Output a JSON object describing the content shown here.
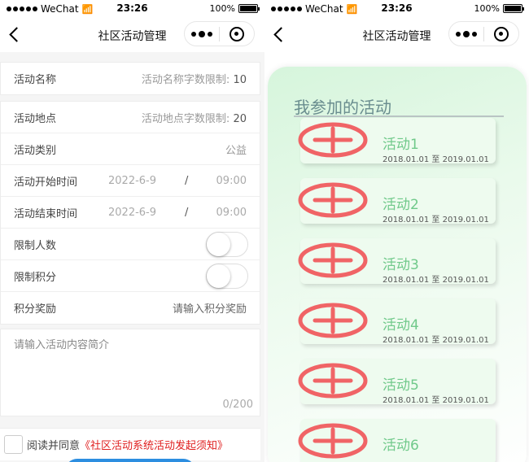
{
  "status": {
    "carrier": "WeChat",
    "time": "23:26",
    "battery": "100%"
  },
  "left": {
    "nav_title": "社区活动管理",
    "rows": {
      "name": {
        "label": "活动名称",
        "hint": "活动名称字数限制:",
        "limit": "10"
      },
      "place": {
        "label": "活动地点",
        "hint": "活动地点字数限制:",
        "limit": "20"
      },
      "category": {
        "label": "活动类别",
        "value": "公益"
      },
      "start": {
        "label": "活动开始时间",
        "date": "2022-6-9",
        "sep": "/",
        "time": "09:00"
      },
      "end": {
        "label": "活动结束时间",
        "date": "2022-6-9",
        "sep": "/",
        "time": "09:00"
      },
      "limit_people": {
        "label": "限制人数"
      },
      "limit_points": {
        "label": "限制积分"
      },
      "reward": {
        "label": "积分奖励",
        "placeholder": "请输入积分奖励"
      }
    },
    "intro_placeholder": "请输入活动内容简介",
    "counter": "0/200",
    "agree_text": "阅读并同意",
    "agree_link": "《社区活动系统活动发起须知》"
  },
  "right": {
    "nav_title": "社区活动管理",
    "section_title": "我参加的活动",
    "items": [
      {
        "name": "活动1",
        "date": "2018.01.01 至 2019.01.01"
      },
      {
        "name": "活动2",
        "date": "2018.01.01 至 2019.01.01"
      },
      {
        "name": "活动3",
        "date": "2018.01.01 至 2019.01.01"
      },
      {
        "name": "活动4",
        "date": "2018.01.01 至 2019.01.01"
      },
      {
        "name": "活动5",
        "date": "2018.01.01 至 2019.01.01"
      },
      {
        "name": "活动6",
        "date": ""
      }
    ]
  },
  "colors": {
    "accent_red": "#f06466",
    "green_text": "#70c98a",
    "link_red": "#e02020",
    "button_blue": "#2d8ee0"
  }
}
